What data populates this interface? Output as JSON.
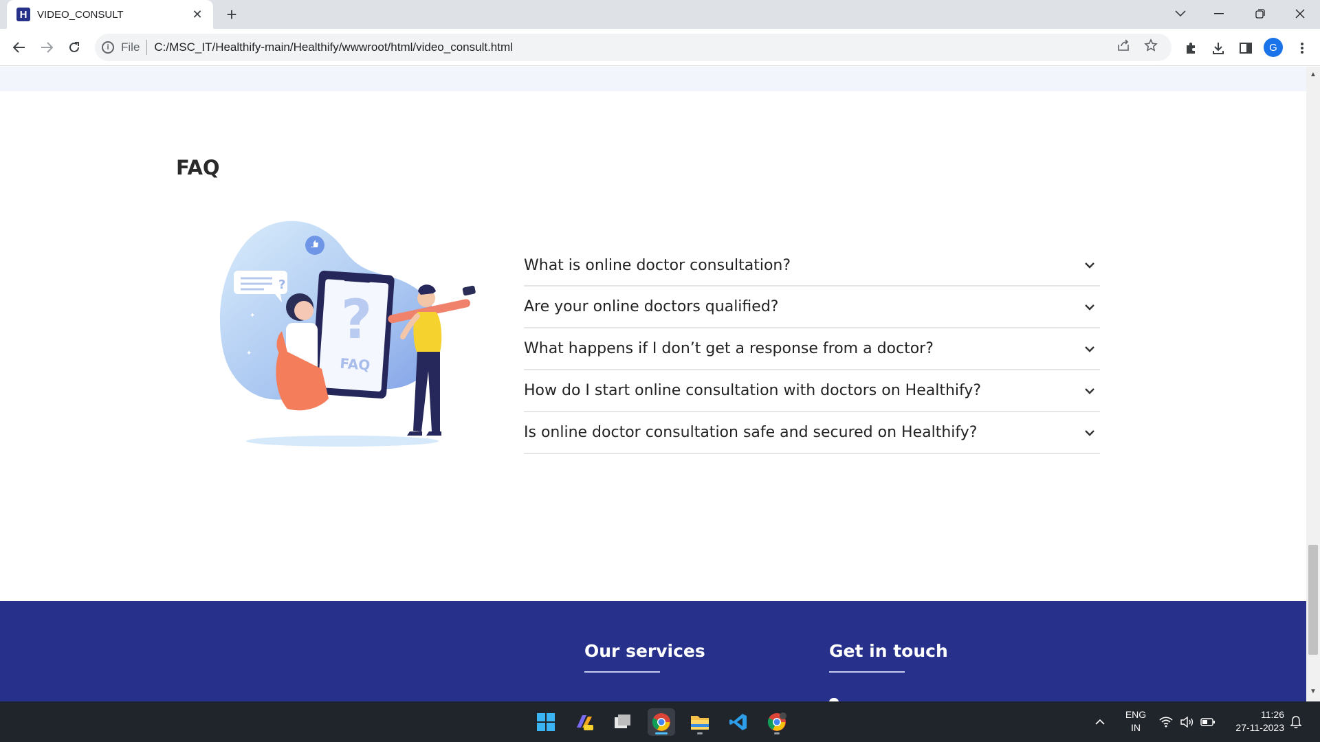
{
  "browser": {
    "tab_title": "VIDEO_CONSULT",
    "tab_favicon_letter": "H",
    "new_tab_label": "+",
    "scheme_label": "File",
    "url": "C:/MSC_IT/Healthify-main/Healthify/wwwroot/html/video_consult.html",
    "profile_initial": "G"
  },
  "page": {
    "faq": {
      "heading": "FAQ",
      "illustration_label": "FAQ",
      "questions": [
        "What is online doctor consultation?",
        "Are your online doctors qualified?",
        "What happens if I don’t get a response from a doctor?",
        "How do I start online consultation with doctors on Healthify?",
        "Is online doctor consultation safe and secured on Healthify?"
      ]
    },
    "footer": {
      "services_heading": "Our services",
      "contact_heading": "Get in touch",
      "background_color": "#27318b"
    }
  },
  "taskbar": {
    "apps": [
      "windows-start-icon",
      "copilot-icon",
      "task-view-icon",
      "chrome-icon",
      "file-explorer-icon",
      "vscode-icon",
      "chrome-canary-icon"
    ],
    "lang_line1": "ENG",
    "lang_line2": "IN",
    "time": "11:26",
    "date": "27-11-2023"
  }
}
